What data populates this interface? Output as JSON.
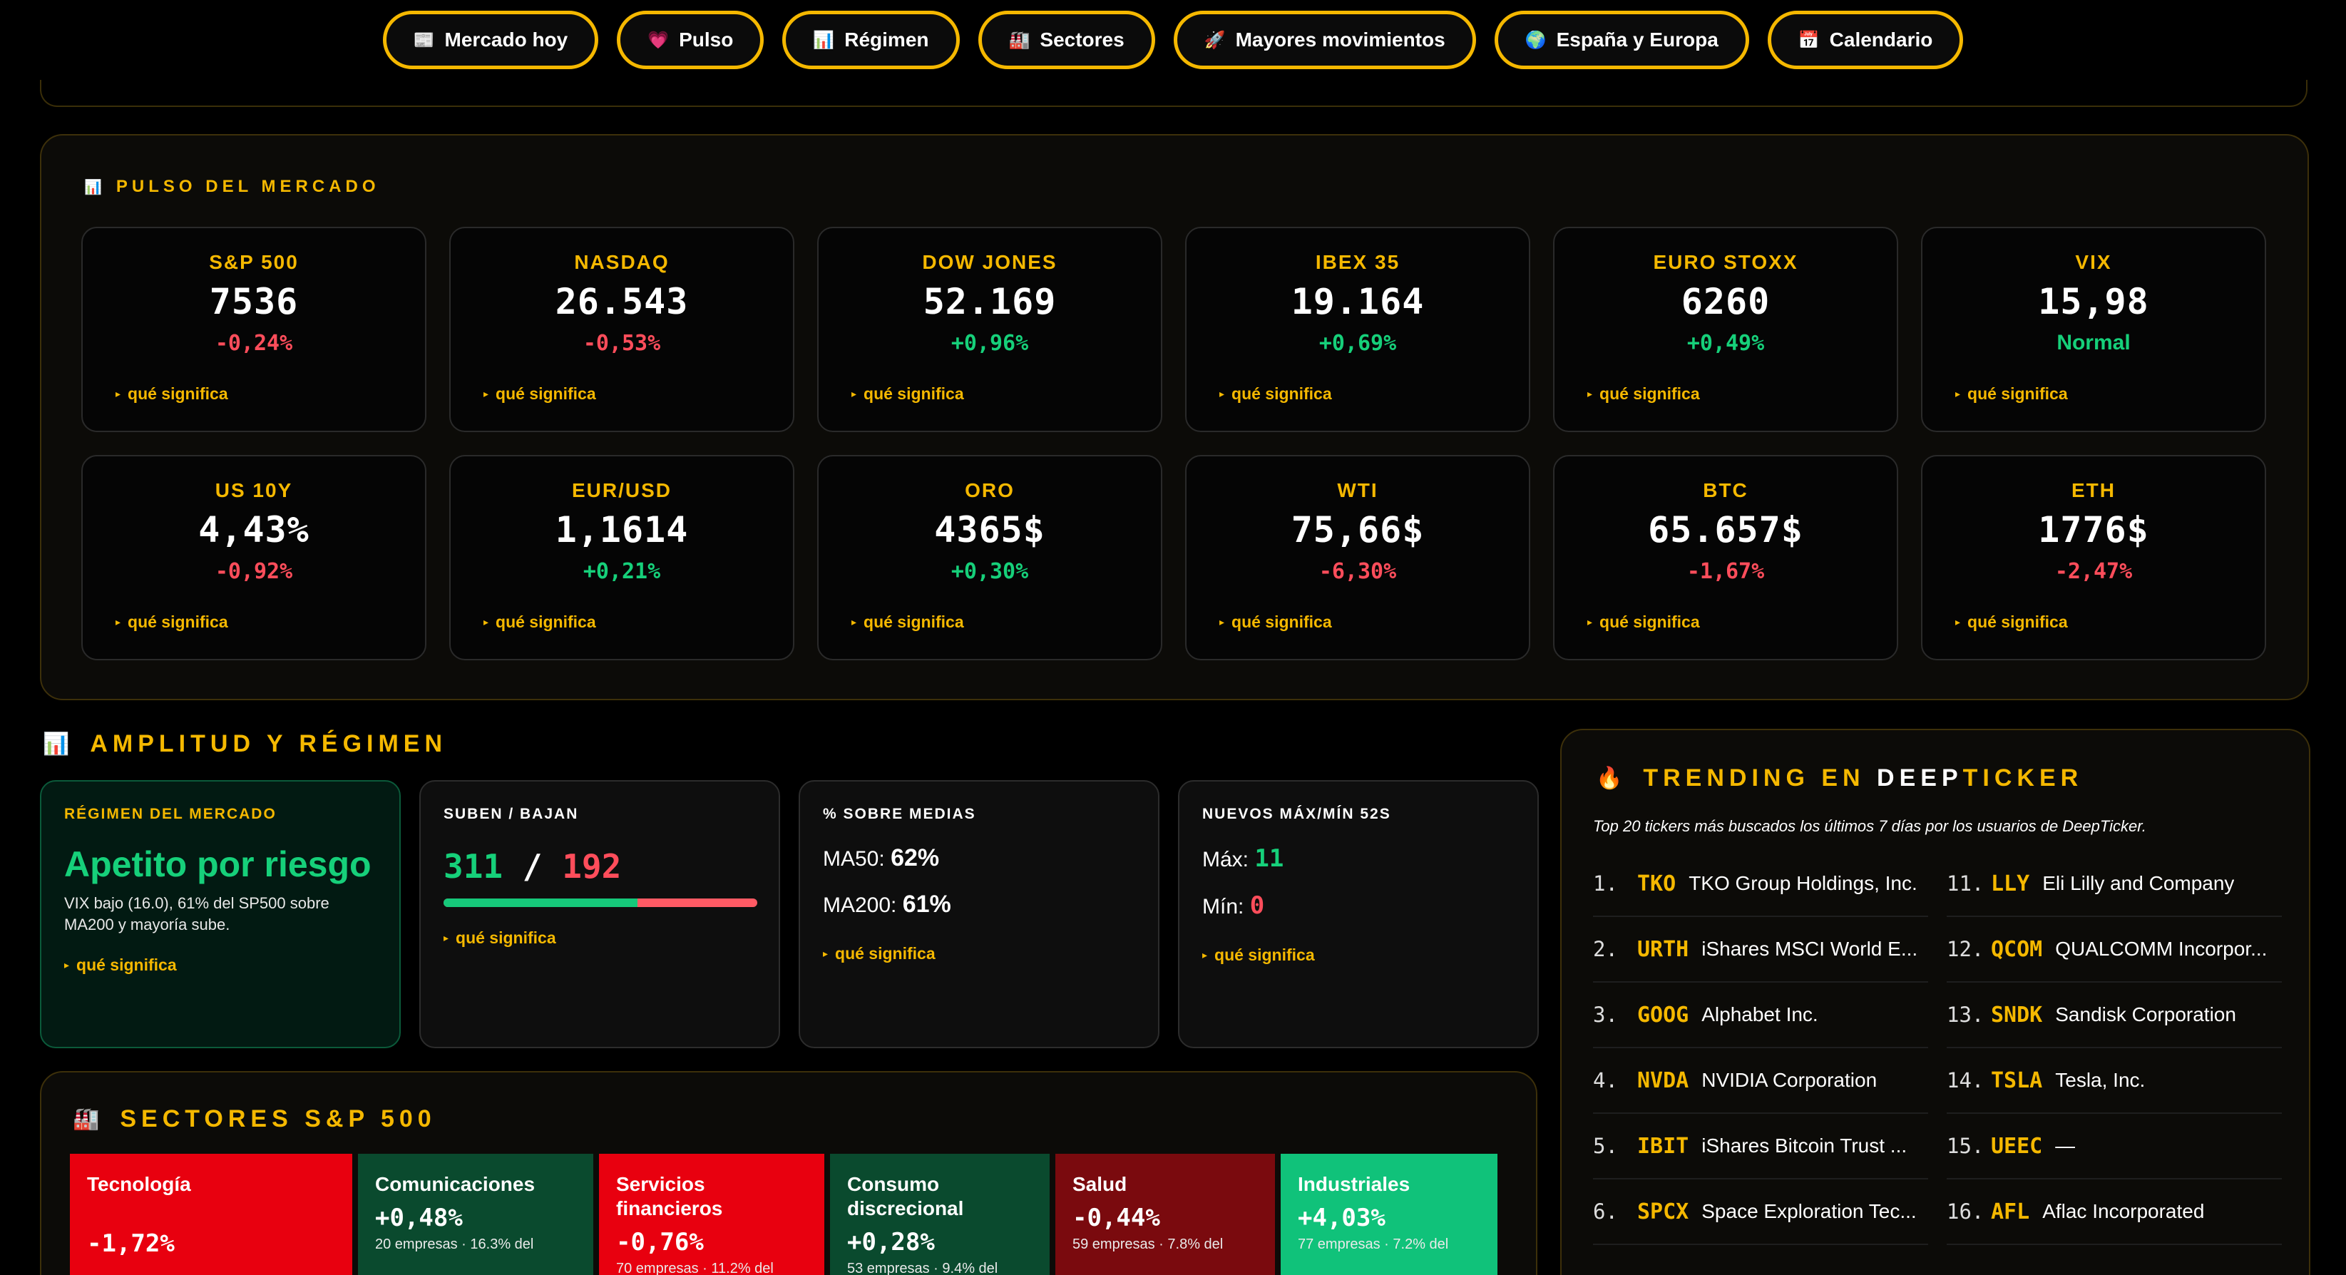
{
  "nav": [
    {
      "icon": "📰",
      "label": "Mercado hoy"
    },
    {
      "icon": "💗",
      "label": "Pulso"
    },
    {
      "icon": "📊",
      "label": "Régimen"
    },
    {
      "icon": "🏭",
      "label": "Sectores"
    },
    {
      "icon": "🚀",
      "label": "Mayores movimientos"
    },
    {
      "icon": "🌍",
      "label": "España y Europa"
    },
    {
      "icon": "📅",
      "label": "Calendario"
    }
  ],
  "pulse": {
    "title": "PULSO DEL MERCADO",
    "cards": [
      {
        "label": "S&P 500",
        "value": "7536",
        "change": "-0,24%",
        "dir": "down"
      },
      {
        "label": "NASDAQ",
        "value": "26.543",
        "change": "-0,53%",
        "dir": "down"
      },
      {
        "label": "DOW JONES",
        "value": "52.169",
        "change": "+0,96%",
        "dir": "up"
      },
      {
        "label": "IBEX 35",
        "value": "19.164",
        "change": "+0,69%",
        "dir": "up"
      },
      {
        "label": "EURO STOXX",
        "value": "6260",
        "change": "+0,49%",
        "dir": "up"
      },
      {
        "label": "VIX",
        "value": "15,98",
        "change": "Normal",
        "dir": "up"
      },
      {
        "label": "US 10Y",
        "value": "4,43%",
        "change": "-0,92%",
        "dir": "down"
      },
      {
        "label": "EUR/USD",
        "value": "1,1614",
        "change": "+0,21%",
        "dir": "up"
      },
      {
        "label": "ORO",
        "value": "4365$",
        "change": "+0,30%",
        "dir": "up"
      },
      {
        "label": "WTI",
        "value": "75,66$",
        "change": "-6,30%",
        "dir": "down"
      },
      {
        "label": "BTC",
        "value": "65.657$",
        "change": "-1,67%",
        "dir": "down"
      },
      {
        "label": "ETH",
        "value": "1776$",
        "change": "-2,47%",
        "dir": "down"
      }
    ],
    "link": "qué significa"
  },
  "amplitud": {
    "title": "AMPLITUD Y RÉGIMEN",
    "regimen": {
      "heading": "RÉGIMEN DEL MERCADO",
      "value": "Apetito por riesgo",
      "desc": "VIX bajo (16.0), 61% del SP500 sobre MA200 y mayoría sube."
    },
    "breadth": {
      "heading": "SUBEN / BAJAN",
      "up": "311",
      "sep": "/",
      "down": "192",
      "up_fraction": 0.618
    },
    "medias": {
      "heading": "% SOBRE MEDIAS",
      "ma50_label": "MA50:",
      "ma50": "62%",
      "ma200_label": "MA200:",
      "ma200": "61%"
    },
    "maxmin": {
      "heading": "NUEVOS MÁX/MÍN 52S",
      "max_label": "Máx:",
      "max": "11",
      "min_label": "Mín:",
      "min": "0"
    }
  },
  "sectores": {
    "title": "SECTORES S&P 500",
    "tiles": [
      {
        "name": "Tecnología",
        "pct": "-1,72%",
        "sub": "",
        "color": "#e8000f"
      },
      {
        "name": "Comunicaciones",
        "pct": "+0,48%",
        "sub": "20 empresas · 16.3% del",
        "color": "#0a4a2e"
      },
      {
        "name": "Servicios financieros",
        "pct": "-0,76%",
        "sub": "70 empresas · 11.2% del",
        "color": "#e8000f"
      },
      {
        "name": "Consumo discrecional",
        "pct": "+0,28%",
        "sub": "53 empresas · 9.4% del",
        "color": "#0a4a2e"
      },
      {
        "name": "Salud",
        "pct": "-0,44%",
        "sub": "59 empresas · 7.8% del",
        "color": "#7a0a0e"
      },
      {
        "name": "Industriales",
        "pct": "+4,03%",
        "sub": "77 empresas · 7.2% del",
        "color": "#10c27a"
      }
    ]
  },
  "trending": {
    "title_a": "TRENDING EN",
    "title_b": "DEEP",
    "title_c": "TICKER",
    "subtitle": "Top 20 tickers más buscados los últimos 7 días por los usuarios de DeepTicker.",
    "left": [
      {
        "n": "1.",
        "t": "TKO",
        "name": "TKO Group Holdings, Inc."
      },
      {
        "n": "2.",
        "t": "URTH",
        "name": "iShares MSCI World E..."
      },
      {
        "n": "3.",
        "t": "GOOG",
        "name": "Alphabet Inc."
      },
      {
        "n": "4.",
        "t": "NVDA",
        "name": "NVIDIA Corporation"
      },
      {
        "n": "5.",
        "t": "IBIT",
        "name": "iShares Bitcoin Trust ..."
      },
      {
        "n": "6.",
        "t": "SPCX",
        "name": "Space Exploration Tec..."
      }
    ],
    "right": [
      {
        "n": "11.",
        "t": "LLY",
        "name": "Eli Lilly and Company"
      },
      {
        "n": "12.",
        "t": "QCOM",
        "name": "QUALCOMM Incorpor..."
      },
      {
        "n": "13.",
        "t": "SNDK",
        "name": "Sandisk Corporation"
      },
      {
        "n": "14.",
        "t": "TSLA",
        "name": "Tesla, Inc."
      },
      {
        "n": "15.",
        "t": "UEEC",
        "name": "—"
      },
      {
        "n": "16.",
        "t": "AFL",
        "name": "Aflac Incorporated"
      }
    ]
  }
}
